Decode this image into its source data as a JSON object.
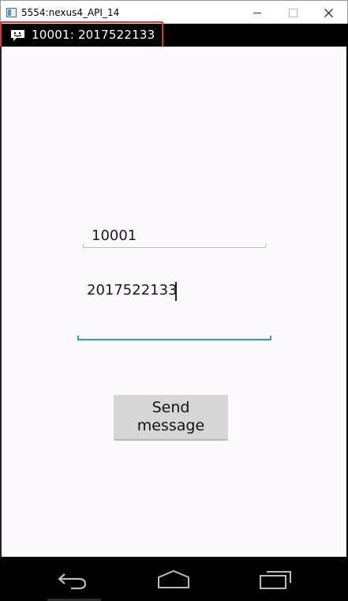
{
  "window": {
    "title": "5554:nexus4_API_14"
  },
  "status_bar": {
    "notification_ticker": "10001: 2017522133",
    "ticker_icon": "message-bubble-icon"
  },
  "form": {
    "phone_number_value": "10001",
    "message_value": "2017522133",
    "empty_field_value": "",
    "send_button_label": "Send message"
  },
  "nav_bar": {
    "icons": [
      "back-icon",
      "home-icon",
      "recent-apps-icon"
    ]
  },
  "colors": {
    "accent_underline": "#2d9bc4",
    "highlight_box": "#d9343b",
    "app_background": "#fdf9fd"
  }
}
